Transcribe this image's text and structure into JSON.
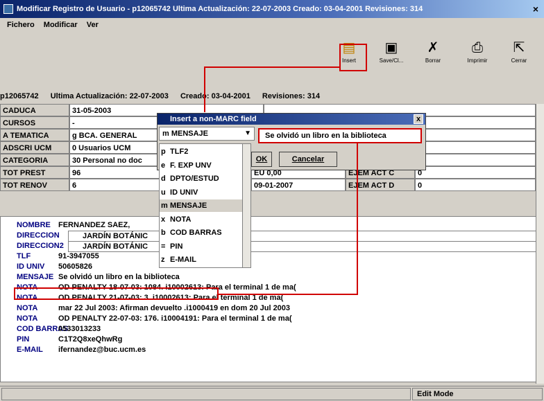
{
  "window": {
    "title": "Modificar Registro de Usuario - p12065742   Ultima Actualización: 22-07-2003   Creado: 03-04-2001   Revisiones: 314"
  },
  "menu": [
    "Fichero",
    "Modificar",
    "Ver"
  ],
  "toolbar": [
    {
      "label": "Insert",
      "icon": "insert-icon"
    },
    {
      "label": "Save/Cl...",
      "icon": "save-icon"
    },
    {
      "label": "Borrar",
      "icon": "delete-icon"
    },
    {
      "label": "Imprimir",
      "icon": "print-icon"
    },
    {
      "label": "Cerrar",
      "icon": "close-door-icon"
    }
  ],
  "info": {
    "id": "p12065742",
    "updated": "Ultima Actualización: 22-07-2003",
    "created": "Creado: 03-04-2001",
    "revisions": "Revisiones: 314"
  },
  "fields": {
    "caduca": {
      "label": "CADUCA",
      "value": "31-05-2003"
    },
    "cursos": {
      "label": "CURSOS",
      "value": "-"
    },
    "atematica": {
      "label": "A TEMATICA",
      "value": "g  BCA. GENERAL"
    },
    "adscri": {
      "label": "ADSCRI UCM",
      "value": "0  Usuarios UCM"
    },
    "categoria": {
      "label": "CATEGORIA",
      "value": "30  Personal no doc"
    },
    "totprest": {
      "label": "TOT PREST",
      "value": "96"
    },
    "totrenov": {
      "label": "TOT RENOV",
      "value": "6"
    },
    "eu": "EU 0,00",
    "fecha": "09-01-2007",
    "ejemc": {
      "label": "EJEM ACT C",
      "value": "0"
    },
    "ejemd": {
      "label": "EJEM ACT D",
      "value": "0"
    }
  },
  "record": [
    {
      "k": "NOMBRE",
      "v": "FERNANDEZ SAEZ,"
    },
    {
      "k": "DIRECCION",
      "v": "JARDÍN BOTÁNIC"
    },
    {
      "k": "DIRECCION2",
      "v": "JARDÍN BOTÁNIC"
    },
    {
      "k": "TLF",
      "v": "91-3947055"
    },
    {
      "k": "ID UNIV",
      "v": "50605826"
    },
    {
      "k": "MENSAJE",
      "v": "Se olvidó un libro en la biblioteca"
    },
    {
      "k": "NOTA",
      "v": "OD PENALTY 18-07-03: 1084. i10002613: Para el terminal 1 de ma("
    },
    {
      "k": "NOTA",
      "v": "OD PENALTY 21-07-03: 3. i10002613: Para el terminal 1 de ma("
    },
    {
      "k": "NOTA",
      "v": "mar 22 Jul 2003: Afirman devuelto .i1000419 en dom 20 Jul 2003"
    },
    {
      "k": "NOTA",
      "v": "OD PENALTY 22-07-03: 176. i10004191: Para el terminal 1 de ma("
    },
    {
      "k": "COD BARRAS",
      "v": "0533013233"
    },
    {
      "k": "PIN",
      "v": "C1T2Q8xeQhwRg"
    },
    {
      "k": "E-MAIL",
      "v": "ifernandez@buc.ucm.es"
    }
  ],
  "dialog": {
    "title": "Insert a non-MARC field",
    "selected": "m MENSAJE",
    "input_value": "Se olvidó un libro en la biblioteca",
    "ok": "OK",
    "cancel": "Cancelar",
    "options": [
      {
        "k": "p",
        "v": "TLF2"
      },
      {
        "k": "e",
        "v": "F. EXP UNV"
      },
      {
        "k": "d",
        "v": "DPTO/ESTUD"
      },
      {
        "k": "u",
        "v": "ID UNIV"
      },
      {
        "k": "m",
        "v": "MENSAJE"
      },
      {
        "k": "x",
        "v": "NOTA"
      },
      {
        "k": "b",
        "v": "COD BARRAS"
      },
      {
        "k": "=",
        "v": "PIN"
      },
      {
        "k": "z",
        "v": "E-MAIL"
      }
    ]
  },
  "status": {
    "mode": "Edit Mode"
  },
  "colors": {
    "highlight": "#d00000",
    "label_blue": "#000080"
  }
}
